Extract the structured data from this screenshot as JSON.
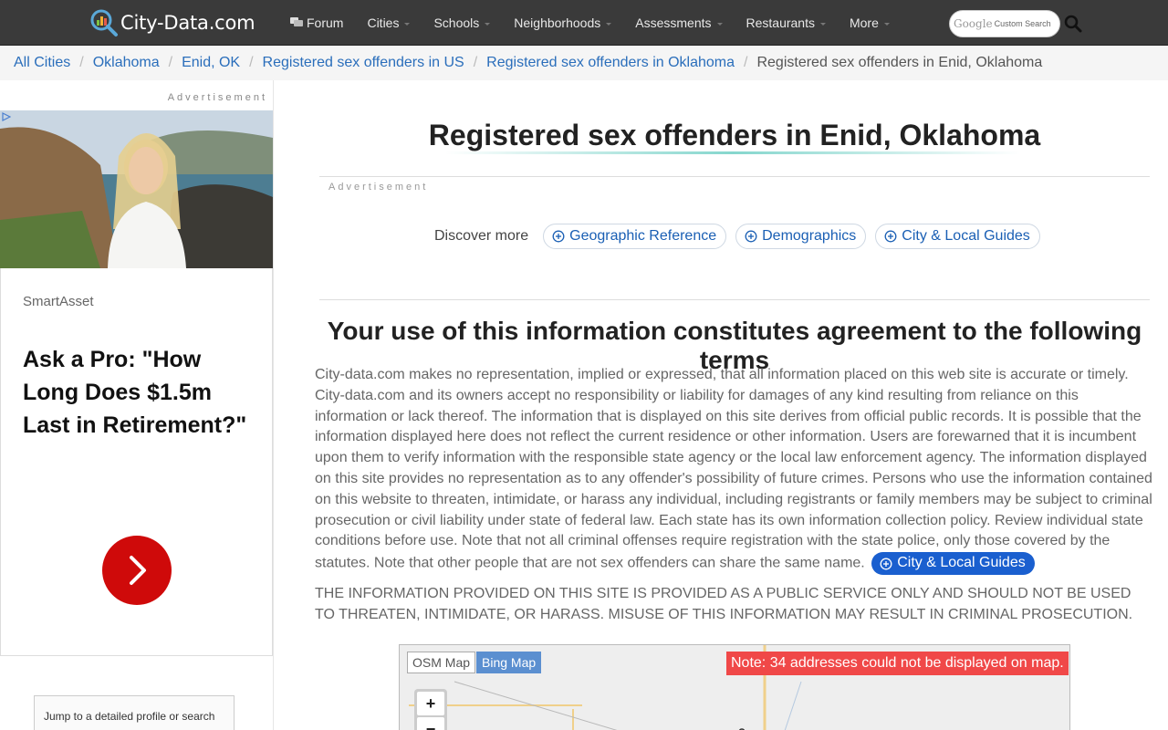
{
  "site": {
    "name": "City-Data.com"
  },
  "nav": [
    {
      "label": "Forum",
      "dropdown": false
    },
    {
      "label": "Cities",
      "dropdown": true
    },
    {
      "label": "Schools",
      "dropdown": true
    },
    {
      "label": "Neighborhoods",
      "dropdown": true
    },
    {
      "label": "Assessments",
      "dropdown": true
    },
    {
      "label": "Restaurants",
      "dropdown": true
    },
    {
      "label": "More",
      "dropdown": true
    }
  ],
  "search": {
    "brand": "Google",
    "placeholder": "Custom Search"
  },
  "breadcrumb": {
    "items": [
      "All Cities",
      "Oklahoma",
      "Enid, OK",
      "Registered sex offenders in US",
      "Registered sex offenders in Oklahoma"
    ],
    "current": "Registered sex offenders in Enid, Oklahoma"
  },
  "ad": {
    "label": "Advertisement",
    "sponsor": "SmartAsset",
    "headline": "Ask a Pro: \"How Long Does $1.5m Last in Retirement?\"",
    "jump_text": "Jump to a detailed profile or search"
  },
  "main": {
    "title": "Registered sex offenders in Enid, Oklahoma",
    "ad_label": "Advertisement",
    "discover_label": "Discover more",
    "chips": [
      "Geographic Reference",
      "Demographics",
      "City & Local Guides"
    ],
    "terms_title": "Your use of this information constitutes agreement to the following terms",
    "terms_body": "City-data.com makes no representation, implied or expressed, that all information placed on this web site is accurate or timely. City-data.com and its owners accept no responsibility or liability for damages of any kind resulting from reliance on this information or lack thereof. The information that is displayed on this site derives from official public records. It is possible that the information displayed here does not reflect the current residence or other information. Users are forewarned that it is incumbent upon them to verify information with the responsible state agency or the local law enforcement agency. The information displayed on this site provides no representation as to any offender's possibility of future crimes. Persons who use the information contained on this website to threaten, intimidate, or harass any individual, including registrants or family members may be subject to criminal prosecution or civil liability under state of federal law. Each state has its own information collection policy. Review individual state conditions before use. Note that not all criminal offenses require registration with the state police, only those covered by the statutes. Note that other people that are not sex offenders can share the same name.",
    "inline_chip": "City & Local Guides",
    "caps_notice": "THE INFORMATION PROVIDED ON THIS SITE IS PROVIDED AS A PUBLIC SERVICE ONLY AND SHOULD NOT BE USED TO THREATEN, INTIMIDATE, OR HARASS. MISUSE OF THIS INFORMATION MAY RESULT IN CRIMINAL PROSECUTION."
  },
  "map": {
    "tabs": [
      "OSM Map",
      "Bing Map"
    ],
    "note": "Note: 34 addresses could not be displayed on map.",
    "zoom_in": "+",
    "zoom_out": "−"
  },
  "colors": {
    "nav_bg": "#3a3a3a",
    "link": "#2a6ebb",
    "chip_text": "#1a5fb4",
    "inline_chip_bg": "#1a5fcf",
    "ad_cta": "#cf0a0a",
    "map_note_bg": "#f04848"
  }
}
